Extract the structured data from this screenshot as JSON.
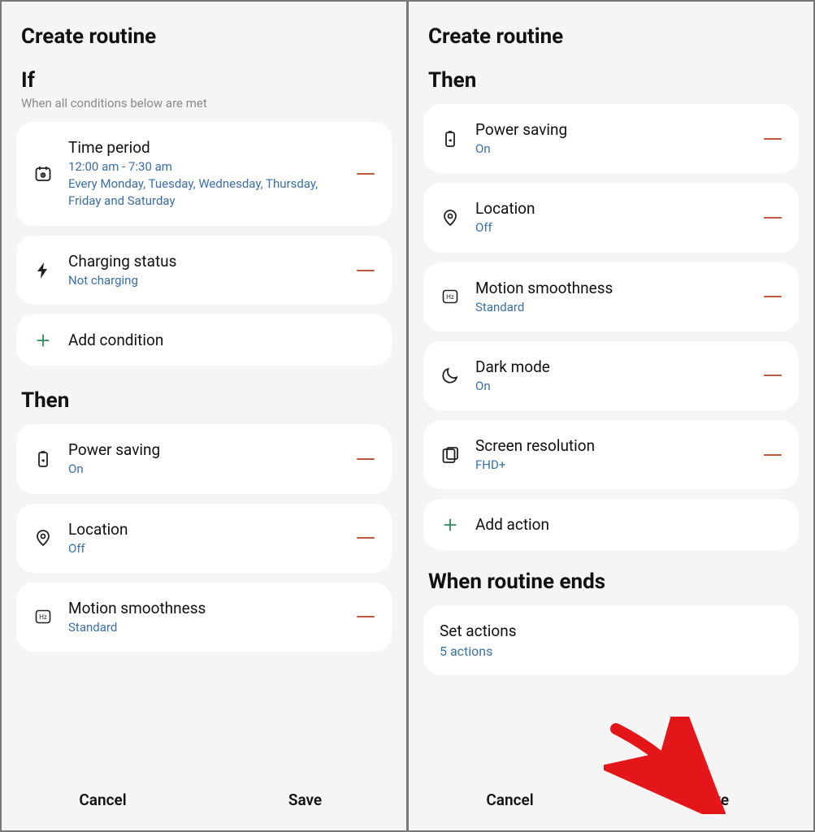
{
  "left": {
    "pageTitle": "Create routine",
    "ifTitle": "If",
    "ifSubtitle": "When all conditions below are met",
    "conditions": [
      {
        "title": "Time period",
        "line1": "12:00  am - 7:30  am",
        "line2": "Every Monday, Tuesday, Wednesday, Thursday, Friday and Saturday"
      },
      {
        "title": "Charging status",
        "value": "Not charging"
      }
    ],
    "addCondition": "Add condition",
    "thenTitle": "Then",
    "actions": [
      {
        "title": "Power saving",
        "value": "On"
      },
      {
        "title": "Location",
        "value": "Off"
      },
      {
        "title": "Motion smoothness",
        "value": "Standard"
      }
    ],
    "cancel": "Cancel",
    "save": "Save"
  },
  "right": {
    "pageTitle": "Create routine",
    "thenTitle": "Then",
    "actions": [
      {
        "title": "Power saving",
        "value": "On"
      },
      {
        "title": "Location",
        "value": "Off"
      },
      {
        "title": "Motion smoothness",
        "value": "Standard"
      },
      {
        "title": "Dark mode",
        "value": "On"
      },
      {
        "title": "Screen resolution",
        "value": "FHD+"
      }
    ],
    "addAction": "Add action",
    "endsTitle": "When routine ends",
    "setActionsTitle": "Set actions",
    "setActionsValue": "5 actions",
    "cancel": "Cancel",
    "save": "Save"
  }
}
